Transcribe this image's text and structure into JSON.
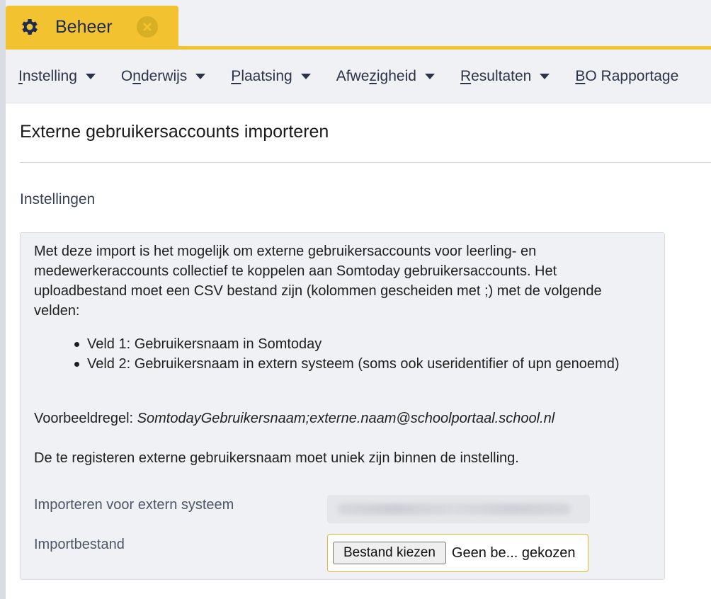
{
  "tab": {
    "title": "Beheer",
    "icon": "gear-icon",
    "close_icon": "close-icon",
    "accent": "#f2c230"
  },
  "nav": {
    "items": [
      {
        "pre": "",
        "key": "I",
        "rest": "nstelling"
      },
      {
        "pre": "O",
        "key": "n",
        "rest": "derwijs"
      },
      {
        "pre": "",
        "key": "P",
        "rest": "laatsing"
      },
      {
        "pre": "Afwe",
        "key": "z",
        "rest": "igheid"
      },
      {
        "pre": "",
        "key": "R",
        "rest": "esultaten"
      },
      {
        "pre": "",
        "key": "B",
        "rest": "O Rapportage"
      }
    ]
  },
  "page": {
    "title": "Externe gebruikersaccounts importeren",
    "section": "Instellingen"
  },
  "panel": {
    "intro": "Met deze import is het mogelijk om externe gebruikersaccounts voor leerling- en medewerkeraccounts collectief te koppelen aan Somtoday gebruikersaccounts. Het uploadbestand moet een CSV bestand zijn (kolommen gescheiden met ;) met de volgende velden:",
    "fields": [
      "Veld 1: Gebruikersnaam in Somtoday",
      "Veld 2: Gebruikersnaam in extern systeem (soms ook useridentifier of upn genoemd)"
    ],
    "example_label": "Voorbeeldregel: ",
    "example_value": "SomtodayGebruikersnaam;externe.naam@schoolportaal.school.nl",
    "note": "De te registeren externe gebruikersnaam moet uniek zijn binnen de instelling."
  },
  "form": {
    "system_label": "Importeren voor extern systeem",
    "file_label": "Importbestand",
    "file_button": "Bestand kiezen",
    "file_status": "Geen be... gekozen"
  }
}
